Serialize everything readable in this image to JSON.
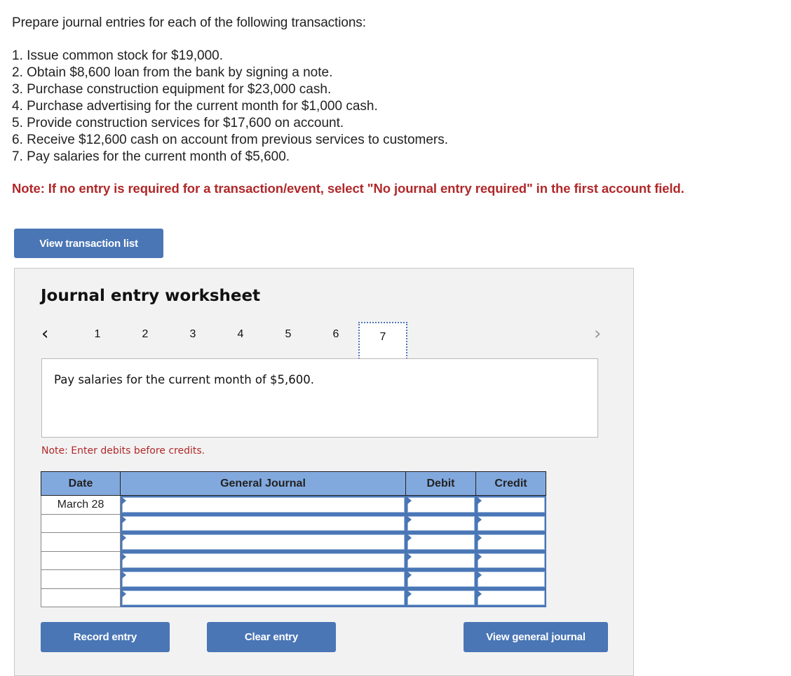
{
  "intro": "Prepare journal entries for each of the following transactions:",
  "transactions": [
    "1. Issue common stock for $19,000.",
    "2. Obtain $8,600 loan from the bank by signing a note.",
    "3. Purchase construction equipment for $23,000 cash.",
    "4. Purchase advertising for the current month for $1,000 cash.",
    "5. Provide construction services for $17,600 on account.",
    "6. Receive $12,600 cash on account from previous services to customers.",
    "7. Pay salaries for the current month of $5,600."
  ],
  "note_top": "Note: If no entry is required for a transaction/event, select \"No journal entry required\" in the first account field.",
  "buttons": {
    "view_transaction_list": "View transaction list",
    "record_entry": "Record entry",
    "clear_entry": "Clear entry",
    "view_general_journal": "View general journal"
  },
  "worksheet": {
    "title": "Journal entry worksheet",
    "pager": {
      "prev_icon": "chevron-left-icon",
      "next_icon": "chevron-right-icon",
      "pages": [
        "1",
        "2",
        "3",
        "4",
        "5",
        "6",
        "7"
      ],
      "active_page": "7"
    },
    "description": "Pay salaries for the current month of $5,600.",
    "note": "Note: Enter debits before credits."
  },
  "journal": {
    "headers": {
      "date": "Date",
      "account": "General Journal",
      "debit": "Debit",
      "credit": "Credit"
    },
    "rows": [
      {
        "date": "March 28",
        "account": "",
        "debit": "",
        "credit": ""
      },
      {
        "date": "",
        "account": "",
        "debit": "",
        "credit": ""
      },
      {
        "date": "",
        "account": "",
        "debit": "",
        "credit": ""
      },
      {
        "date": "",
        "account": "",
        "debit": "",
        "credit": ""
      },
      {
        "date": "",
        "account": "",
        "debit": "",
        "credit": ""
      },
      {
        "date": "",
        "account": "",
        "debit": "",
        "credit": ""
      }
    ]
  },
  "colors": {
    "accent": "#4a76b5",
    "header_bg": "#82a9de",
    "note_red": "#b0282a",
    "panel_bg": "#f2f2f2"
  }
}
